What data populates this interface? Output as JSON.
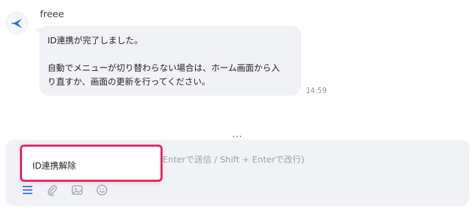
{
  "chat": {
    "sender": "freee",
    "message_line1": "ID連携が完了しました。",
    "message_line2": "自動でメニューが切り替わらない場合は、ホーム画面から入\nり直すか、画面の更新を行ってください。",
    "time": "14:59",
    "more": "..."
  },
  "composer": {
    "placeholder": "Enterで送信 / Shift + Enterで改行)",
    "tools": [
      "menu-icon",
      "paperclip-icon",
      "image-icon",
      "emoji-icon"
    ]
  },
  "suggestion": {
    "label": "ID連携解除"
  },
  "colors": {
    "accent": "#2f6be0",
    "highlight_border": "#f0205f",
    "bubble_bg": "#f1f2f6",
    "icon_gray": "#a3a8b2"
  }
}
